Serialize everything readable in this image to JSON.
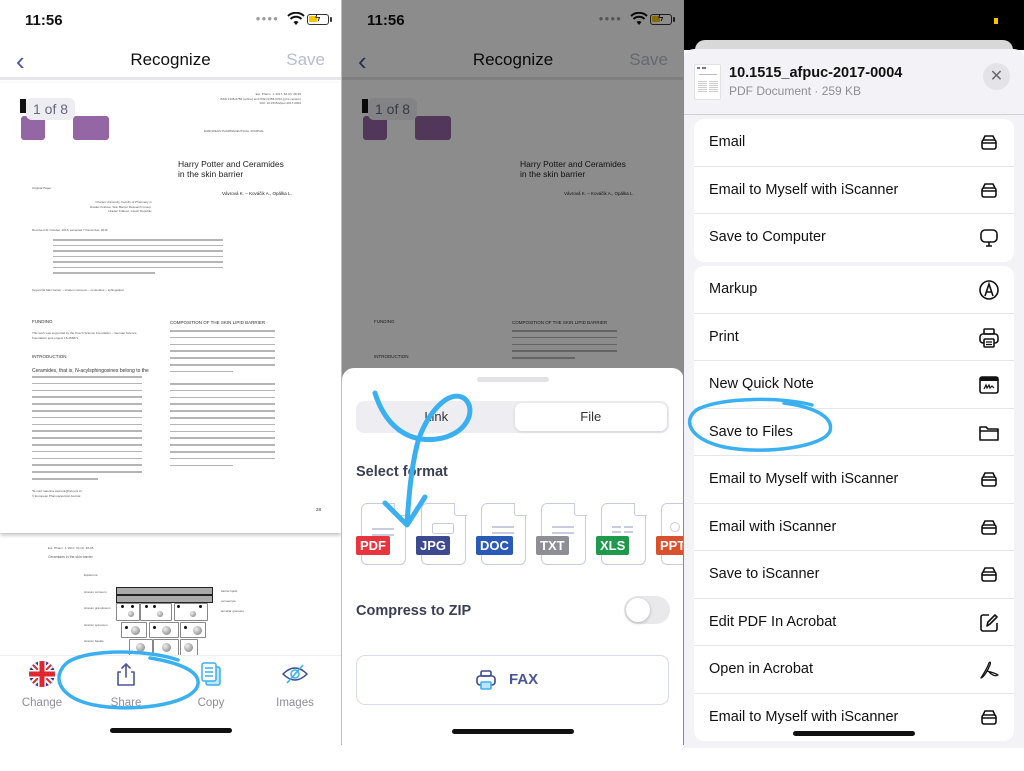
{
  "status_bar": {
    "time": "11:56"
  },
  "nav": {
    "back_icon": "chevron-left",
    "title": "Recognize",
    "save_label": "Save"
  },
  "document": {
    "page_indicator": "1 of 8",
    "header_lines": [
      "Eur. Pharm. J. 2017, 64 (2): 28-35",
      "ISSN 1338-6786 (online) and ISSN 0453-6703 (print version)",
      "DOI: 10.1515/afpuc-2017-0004"
    ],
    "journal": "EUROPEAN PHARMACEUTICAL JOURNAL",
    "title_line1": "Harry Potter and Ceramides",
    "title_line2": "in the skin barrier",
    "paper_type": "Original Paper",
    "authors": "Vávrová K. – Kováčik A., Opálka L.",
    "affiliation": [
      "Charles University, Faculty of Pharmacy in",
      "Hradec Králové, Skin Barrier Research Group,",
      "Hradec Králové, Czech Republic"
    ],
    "received": "Received 31 October, 2016; accepted 7 December, 2016",
    "keywords": "Keywords Skin barrier – stratum corneum – ceramides – sphingolipid",
    "funding_head": "FUNDING",
    "funding_text": "This work was supported by the Czech Science Foundation – German Science Foundation joint project 16-25687J.",
    "intro_head": "INTRODUCTION",
    "intro_lead": "Ceramides, that is, N-acylsphingosines belong to the",
    "composition_head": "COMPOSITION OF THE SKIN LIPID BARRIER",
    "footnote": [
      "*E-mail: katerina.vavrova@faf.cuni.cz",
      "© European Pharmaceutical Journal"
    ],
    "page_number": "28",
    "page2_header": "Eur. Pharm. J. 2017, 64 (2): 28-35",
    "page2_title": "Ceramides in the skin barrier",
    "diagram": {
      "title": "Epidermis:",
      "layers": [
        "stratum corneum",
        "stratum granulosum",
        "stratum spinosum",
        "stratum basale"
      ],
      "labels": [
        "barrier lipids",
        "corneocyte",
        "lamellar granules"
      ]
    }
  },
  "toolbar": {
    "items": [
      {
        "label": "Change",
        "icon": "uk-flag"
      },
      {
        "label": "Share",
        "icon": "share"
      },
      {
        "label": "Copy",
        "icon": "copy"
      },
      {
        "label": "Images",
        "icon": "eye-slash"
      }
    ]
  },
  "export_sheet": {
    "segments": [
      {
        "label": "Link",
        "selected": false
      },
      {
        "label": "File",
        "selected": true
      }
    ],
    "select_format_label": "Select format",
    "formats": [
      {
        "label": "PDF",
        "color": "#e8343c"
      },
      {
        "label": "JPG",
        "color": "#3d4a8f"
      },
      {
        "label": "DOC",
        "color": "#2a5ab8"
      },
      {
        "label": "TXT",
        "color": "#8e8e96"
      },
      {
        "label": "XLS",
        "color": "#1f9a4c"
      },
      {
        "label": "PPT",
        "color": "#d9502c"
      }
    ],
    "compress_label": "Compress to ZIP",
    "compress_enabled": false,
    "fax_label": "FAX"
  },
  "share_sheet": {
    "file_name": "10.1515_afpuc-2017-0004",
    "file_meta": "PDF Document · 259 KB",
    "group1": [
      {
        "label": "Email",
        "icon": "scanner"
      },
      {
        "label": "Email to Myself with iScanner",
        "icon": "scanner"
      },
      {
        "label": "Save to Computer",
        "icon": "computer"
      }
    ],
    "group2": [
      {
        "label": "Markup",
        "icon": "markup"
      },
      {
        "label": "Print",
        "icon": "printer"
      },
      {
        "label": "New Quick Note",
        "icon": "quick-note"
      },
      {
        "label": "Save to Files",
        "icon": "folder"
      },
      {
        "label": "Email to Myself with iScanner",
        "icon": "scanner"
      },
      {
        "label": "Email with iScanner",
        "icon": "scanner"
      },
      {
        "label": "Save to iScanner",
        "icon": "scanner"
      },
      {
        "label": "Edit PDF In Acrobat",
        "icon": "edit"
      },
      {
        "label": "Open in Acrobat",
        "icon": "acrobat"
      },
      {
        "label": "Email to Myself with iScanner",
        "icon": "scanner"
      }
    ]
  },
  "colors": {
    "accent": "#4b5599",
    "annotation": "#3ab0f0",
    "doc_highlight": "#9467a4"
  }
}
